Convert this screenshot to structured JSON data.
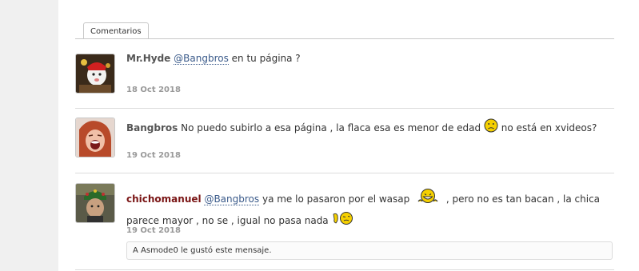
{
  "tab": {
    "label": "Comentarios"
  },
  "comments": [
    {
      "author": "Mr.Hyde",
      "mention": "@Bangbros",
      "text": "en tu página ?",
      "date": "18 Oct 2018"
    },
    {
      "author": "Bangbros",
      "text": "No puedo subirlo a esa página , la flaca esa es menor de edad",
      "text_after": "no está en xvideos?",
      "smiley": "sad-smiley-icon",
      "date": "19 Oct 2018"
    },
    {
      "author": "chichomanuel",
      "mention": "@Bangbros",
      "text": "ya me lo pasaron por el wasap",
      "text_mid": ", pero no es tan bacan , la chica",
      "text_line2": "parece mayor , no se , igual no pasa nada",
      "date": "19 Oct 2018",
      "likes": {
        "prefix": "A",
        "user": "Asmode0",
        "suffix": "le gustó este mensaje."
      }
    }
  ],
  "colors": {
    "author_red": "#7a1515",
    "mention": "#3a5a8a",
    "smiley_yellow": "#f5d000"
  }
}
